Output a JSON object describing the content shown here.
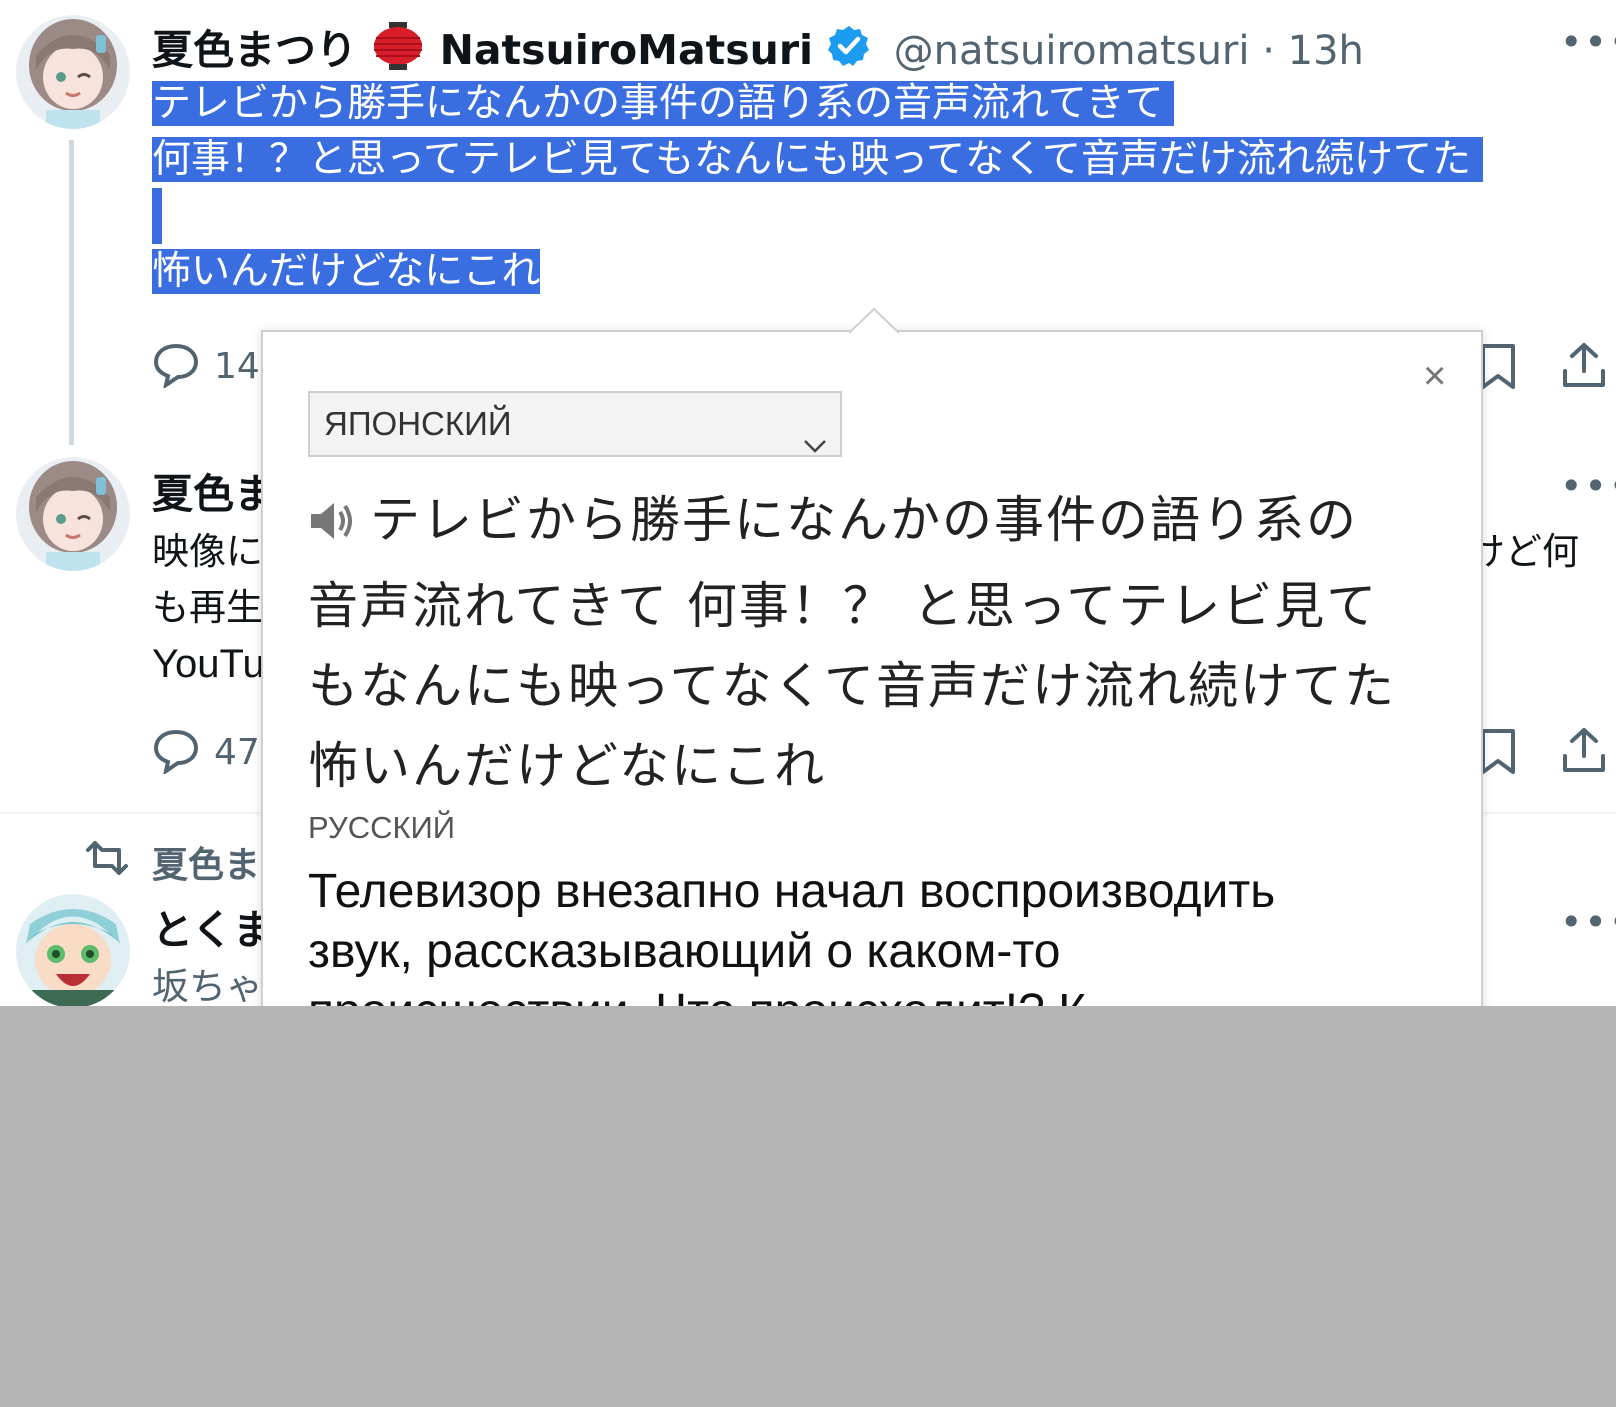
{
  "tweet1": {
    "display_name": "夏色まつり",
    "name_suffix": "NatsuiroMatsuri",
    "handle_time": "@natsuiromatsuri · 13h",
    "more": "•••",
    "text_lines": [
      "テレビから勝手になんかの事件の語り系の音声流れてきて",
      "何事！？と思ってテレビ見てもなんにも映ってなくて音声だけ流れ続けてた",
      "怖いんだけどなにこれ"
    ],
    "reply_count_partial": "14",
    "icons": [
      "reply-icon",
      "bookmark-icon",
      "share-icon"
    ]
  },
  "tweet2": {
    "display_name_partial": "夏色ま",
    "text_partial_line1": "映像に",
    "text_partial_line1_right": "けど何",
    "text_partial_line2": "も再生",
    "text_partial_line3": "YouTu",
    "reply_count_partial": "47",
    "more": "•••"
  },
  "tweet3": {
    "retweet_label_partial": "夏色ま",
    "display_name_partial": "とくま",
    "text_partial": "坂ちゃ",
    "more": "•••",
    "icons": [
      "retweet-icon"
    ]
  },
  "popup": {
    "close": "×",
    "source_language": "ЯПОНСКИЙ",
    "source_text": "テレビから勝手になんかの事件の語り系の音声流れてきて 何事！？ と思ってテレビ見てもなんにも映ってなくて音声だけ流れ続けてた 怖いんだけどなにこれ",
    "target_language": "РУССКИЙ",
    "target_text_lines": [
      "Телевизор внезапно начал воспроизводить",
      "звук, рассказывающий о каком-то",
      "происшествии. Что происходит!? К"
    ],
    "icons": [
      "speaker-icon",
      "chevron-down-icon",
      "close-icon"
    ]
  },
  "colors": {
    "selection": "#3a6ee0",
    "verified": "#1d9bf0",
    "muted": "#536471",
    "backdrop": "#b5b5b5"
  }
}
